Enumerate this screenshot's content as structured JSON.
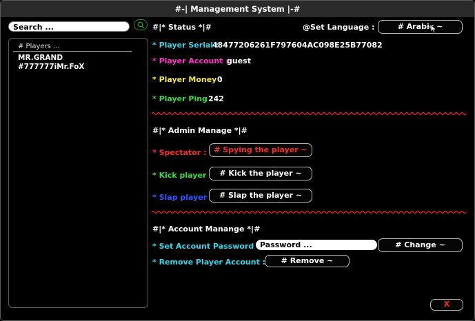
{
  "title": "#-| Management System |-#",
  "search": {
    "placeholder": "Search ..."
  },
  "players": {
    "header": "# Players ...",
    "items": [
      "MR.GRAND",
      "#777777iMr.FoX"
    ]
  },
  "status": {
    "heading": "#|* Status *|#",
    "language_label": "@Set Language :",
    "language_button": "# Arabic ~",
    "serial_label": "* Player Serial :",
    "serial_value": "48477206261F797604AC098E25B77082",
    "account_label": "* Player Account :",
    "account_value": "guest",
    "money_label": "* Player Money :",
    "money_value": "0",
    "ping_label": "* Player Ping :",
    "ping_value": "242"
  },
  "admin": {
    "heading": "#|* Admin Manage *|#",
    "spectator_label": "* Spectator :",
    "spectator_button": "# Spying the player ~",
    "kick_label": "* Kick player :",
    "kick_button": "# Kick the player ~",
    "slap_label": "* Slap player :",
    "slap_button": "# Slap the player ~"
  },
  "account": {
    "heading": "#|* Account Manange *|#",
    "password_label": "* Set Account Password :",
    "password_placeholder": "Password ...",
    "change_button": "# Change ~",
    "remove_label": "* Remove Player Account :",
    "remove_button": "# Remove ~"
  },
  "close_button": "X",
  "colors": {
    "cyan": "#33d6e8",
    "magenta": "#ff33cc",
    "yellow": "#f5e830",
    "green": "#33dd44",
    "red": "#ff2a2a",
    "blue": "#2b58ff"
  }
}
